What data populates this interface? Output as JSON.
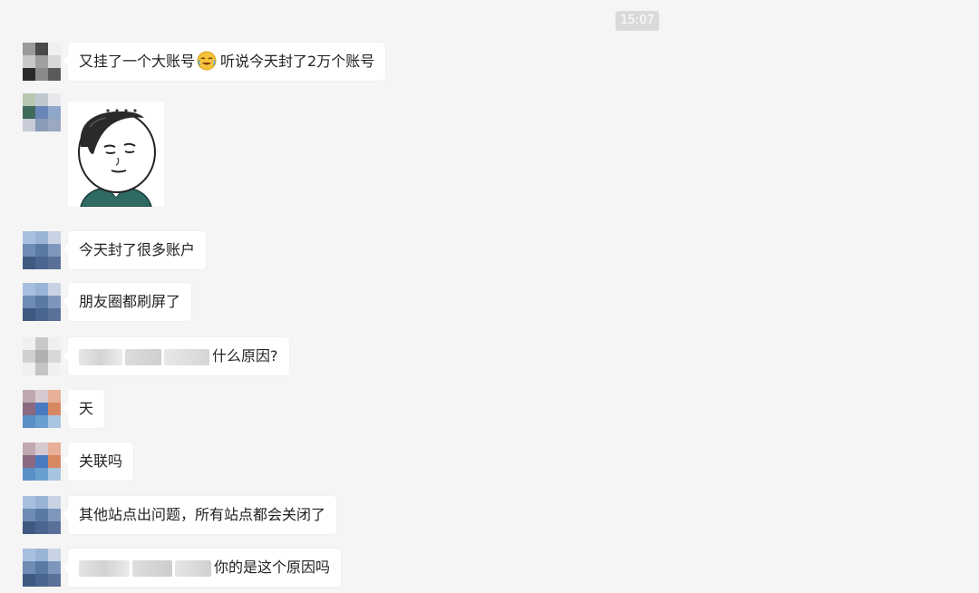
{
  "chat": {
    "timestamp": "15:07",
    "messages": [
      {
        "text_before": "又挂了一个大账号",
        "text_after": "听说今天封了2万个账号",
        "emoji": "crying-laughing-face-icon"
      },
      {
        "type": "sticker",
        "sticker": "meme-face-sticker"
      },
      {
        "text": "今天封了很多账户"
      },
      {
        "text": "朋友圈都刷屏了"
      },
      {
        "text": "什么原因?",
        "redacted_prefix": true
      },
      {
        "text": "天"
      },
      {
        "text": "关联吗"
      },
      {
        "text": "其他站点出问题，所有站点都会关闭了"
      },
      {
        "text": "你的是这个原因吗",
        "redacted_prefix": true
      }
    ]
  },
  "colors": {
    "background": "#f5f5f5",
    "bubble": "#ffffff",
    "timestamp_badge": "#dadada"
  }
}
